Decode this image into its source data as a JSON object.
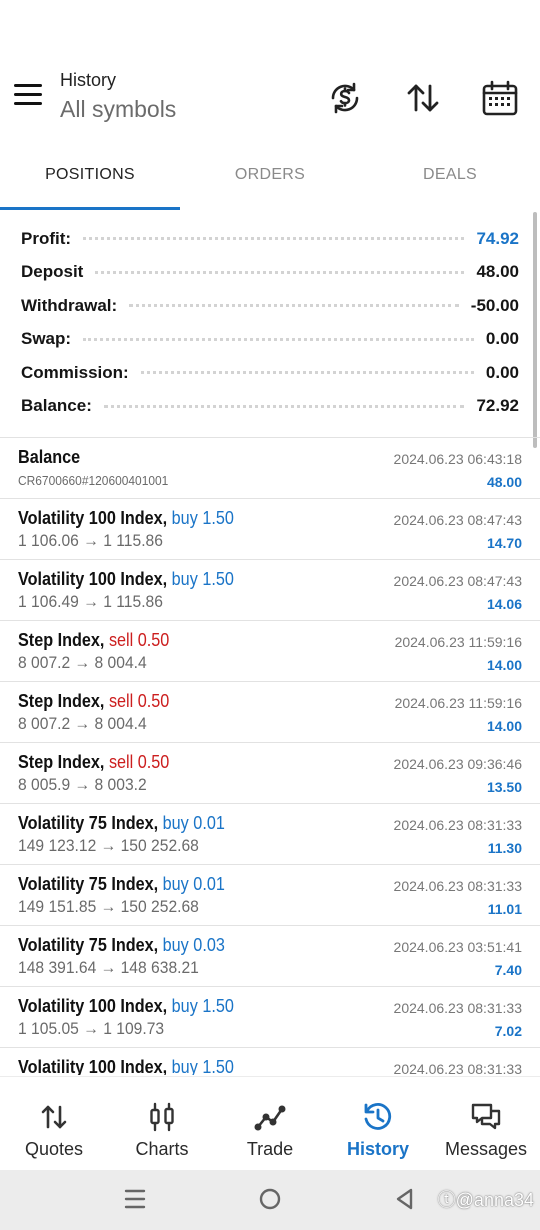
{
  "header": {
    "title": "History",
    "subtitle": "All symbols"
  },
  "tabs": [
    {
      "label": "POSITIONS",
      "active": true
    },
    {
      "label": "ORDERS",
      "active": false
    },
    {
      "label": "DEALS",
      "active": false
    }
  ],
  "summary": {
    "profit_label": "Profit:",
    "profit": "74.92",
    "deposit_label": "Deposit",
    "deposit": "48.00",
    "withdrawal_label": "Withdrawal:",
    "withdrawal": "-50.00",
    "swap_label": "Swap:",
    "swap": "0.00",
    "commission_label": "Commission:",
    "commission": "0.00",
    "balance_label": "Balance:",
    "balance": "72.92"
  },
  "deals": [
    {
      "symbol": "Balance",
      "side": "",
      "volume": "",
      "prices": "CR6700660#120600401001",
      "datetime": "2024.06.23 06:43:18",
      "profit": "48.00"
    },
    {
      "symbol": "Volatility 100 Index,",
      "side": "buy",
      "volume": "1.50",
      "prices": "1 106.06 → 1 115.86",
      "datetime": "2024.06.23 08:47:43",
      "profit": "14.70"
    },
    {
      "symbol": "Volatility 100 Index,",
      "side": "buy",
      "volume": "1.50",
      "prices": "1 106.49 → 1 115.86",
      "datetime": "2024.06.23 08:47:43",
      "profit": "14.06"
    },
    {
      "symbol": "Step Index,",
      "side": "sell",
      "volume": "0.50",
      "prices": "8 007.2 → 8 004.4",
      "datetime": "2024.06.23 11:59:16",
      "profit": "14.00"
    },
    {
      "symbol": "Step Index,",
      "side": "sell",
      "volume": "0.50",
      "prices": "8 007.2 → 8 004.4",
      "datetime": "2024.06.23 11:59:16",
      "profit": "14.00"
    },
    {
      "symbol": "Step Index,",
      "side": "sell",
      "volume": "0.50",
      "prices": "8 005.9 → 8 003.2",
      "datetime": "2024.06.23 09:36:46",
      "profit": "13.50"
    },
    {
      "symbol": "Volatility 75 Index,",
      "side": "buy",
      "volume": "0.01",
      "prices": "149 123.12 → 150 252.68",
      "datetime": "2024.06.23 08:31:33",
      "profit": "11.30"
    },
    {
      "symbol": "Volatility 75 Index,",
      "side": "buy",
      "volume": "0.01",
      "prices": "149 151.85 → 150 252.68",
      "datetime": "2024.06.23 08:31:33",
      "profit": "11.01"
    },
    {
      "symbol": "Volatility 75 Index,",
      "side": "buy",
      "volume": "0.03",
      "prices": "148 391.64 → 148 638.21",
      "datetime": "2024.06.23 03:51:41",
      "profit": "7.40"
    },
    {
      "symbol": "Volatility 100 Index,",
      "side": "buy",
      "volume": "1.50",
      "prices": "1 105.05 → 1 109.73",
      "datetime": "2024.06.23 08:31:33",
      "profit": "7.02"
    },
    {
      "symbol": "Volatility 100 Index,",
      "side": "buy",
      "volume": "1.50",
      "prices": "",
      "datetime": "2024.06.23 08:31:33",
      "profit": ""
    }
  ],
  "bottom_nav": [
    {
      "label": "Quotes",
      "icon": "quotes-icon"
    },
    {
      "label": "Charts",
      "icon": "charts-icon"
    },
    {
      "label": "Trade",
      "icon": "trade-icon"
    },
    {
      "label": "History",
      "icon": "history-icon",
      "active": true
    },
    {
      "label": "Messages",
      "icon": "messages-icon"
    }
  ],
  "watermark": "ⓣ@anna34",
  "colors": {
    "accent": "#1a74c7",
    "sell": "#cc1e1e",
    "buy": "#1a74c7"
  }
}
